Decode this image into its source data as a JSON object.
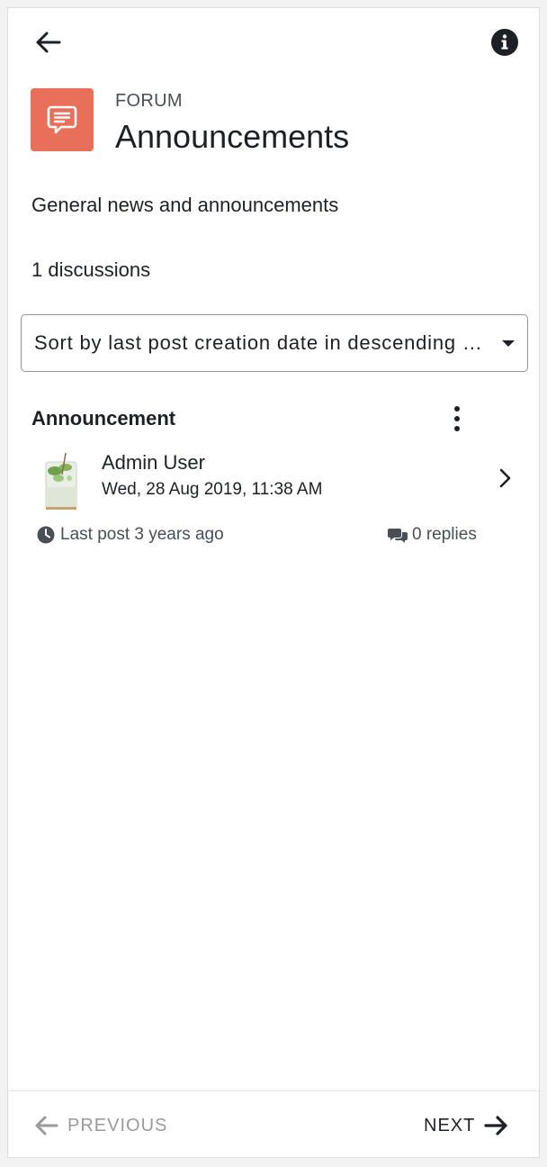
{
  "header": {
    "back_icon": "arrow-left-icon",
    "info_icon": "info-circle-icon"
  },
  "activity": {
    "type_label": "FORUM",
    "title": "Announcements",
    "icon": "forum-chat-bubble-icon",
    "icon_color": "#e8705a",
    "description": "General news and announcements",
    "discussion_count": "1 discussions"
  },
  "sort": {
    "selected": "Sort by last post creation date in descending order"
  },
  "discussions": [
    {
      "subject": "Announcement",
      "author": "Admin User",
      "date": "Wed, 28 Aug 2019, 11:38 AM",
      "last_post": "Last post 3 years ago",
      "replies": "0 replies"
    }
  ],
  "footer": {
    "previous_label": "PREVIOUS",
    "next_label": "NEXT",
    "previous_color": "#9a9a9a",
    "next_color": "#1d2125"
  }
}
